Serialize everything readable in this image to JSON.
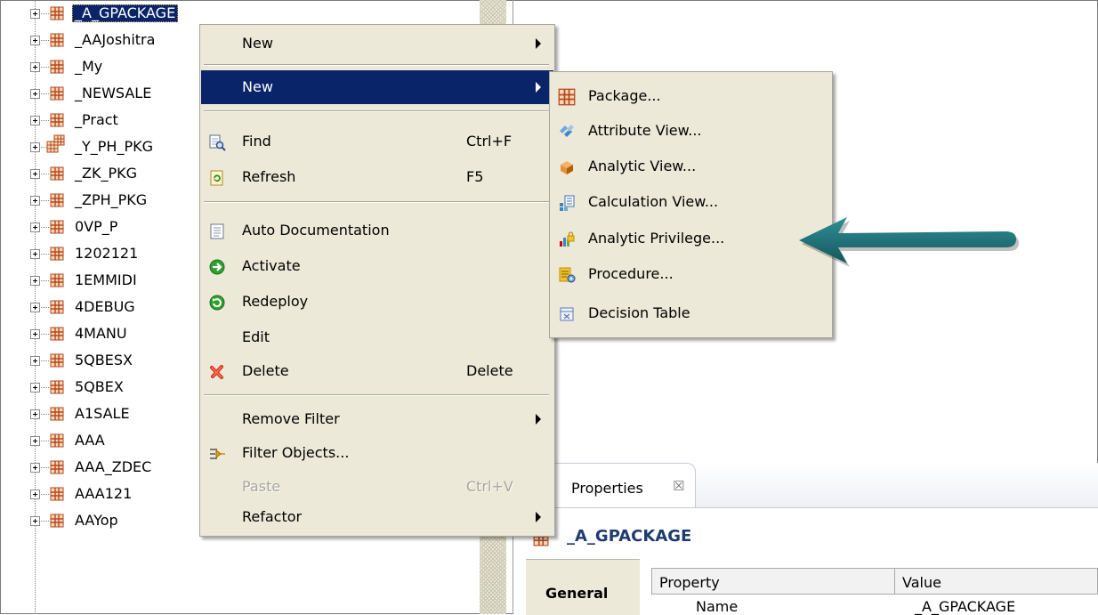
{
  "tree": {
    "items": [
      {
        "label": "_A_GPACKAGE",
        "selected": true
      },
      {
        "label": "_AAJoshitra"
      },
      {
        "label": "_My"
      },
      {
        "label": "_NEWSALE"
      },
      {
        "label": "_Pract"
      },
      {
        "label": "_Y_PH_PKG"
      },
      {
        "label": "_ZK_PKG"
      },
      {
        "label": "_ZPH_PKG"
      },
      {
        "label": "0VP_P"
      },
      {
        "label": "1202121"
      },
      {
        "label": "1EMMIDI"
      },
      {
        "label": "4DEBUG"
      },
      {
        "label": "4MANU"
      },
      {
        "label": "5QBESX"
      },
      {
        "label": "5QBEX"
      },
      {
        "label": "A1SALE"
      },
      {
        "label": "AAA"
      },
      {
        "label": "AAA_ZDEC"
      },
      {
        "label": "AAA121"
      },
      {
        "label": "AAYop"
      }
    ]
  },
  "context_menu": {
    "items": [
      {
        "label": "New",
        "submenu": true
      },
      {
        "label": "New",
        "submenu": true,
        "highlighted": true
      },
      {
        "label": "Find",
        "accel": "Ctrl+F",
        "icon": "find-icon"
      },
      {
        "label": "Refresh",
        "accel": "F5",
        "icon": "refresh-icon"
      },
      {
        "label": "Auto Documentation",
        "icon": "document-icon"
      },
      {
        "label": "Activate",
        "icon": "activate-icon"
      },
      {
        "label": "Redeploy",
        "icon": "redeploy-icon"
      },
      {
        "label": "Edit"
      },
      {
        "label": "Delete",
        "accel": "Delete",
        "icon": "delete-icon"
      },
      {
        "label": "Remove Filter",
        "submenu": true
      },
      {
        "label": "Filter Objects...",
        "icon": "filter-icon"
      },
      {
        "label": "Paste",
        "accel": "Ctrl+V",
        "disabled": true
      },
      {
        "label": "Refactor",
        "submenu": true
      }
    ]
  },
  "submenu": {
    "items": [
      {
        "label": "Package...",
        "icon": "package-icon"
      },
      {
        "label": "Attribute View...",
        "icon": "attribute-view-icon"
      },
      {
        "label": "Analytic View...",
        "icon": "analytic-view-icon"
      },
      {
        "label": "Calculation View...",
        "icon": "calculation-view-icon"
      },
      {
        "label": "Analytic Privilege...",
        "icon": "analytic-privilege-icon"
      },
      {
        "label": "Procedure...",
        "icon": "procedure-icon"
      },
      {
        "label": "Decision Table",
        "icon": "decision-table-icon"
      }
    ]
  },
  "properties": {
    "tab_label": "Properties",
    "close_glyph": "☒",
    "title": "_A_GPACKAGE",
    "section_label": "General",
    "columns": [
      "Property",
      "Value"
    ],
    "row": {
      "property": "Name",
      "value": "_A_GPACKAGE"
    }
  },
  "colors": {
    "selection": "#0a246a",
    "menu_bg": "#ece9d8",
    "annotation_arrow": "#1f6b70",
    "package_icon": "#c0392b"
  }
}
